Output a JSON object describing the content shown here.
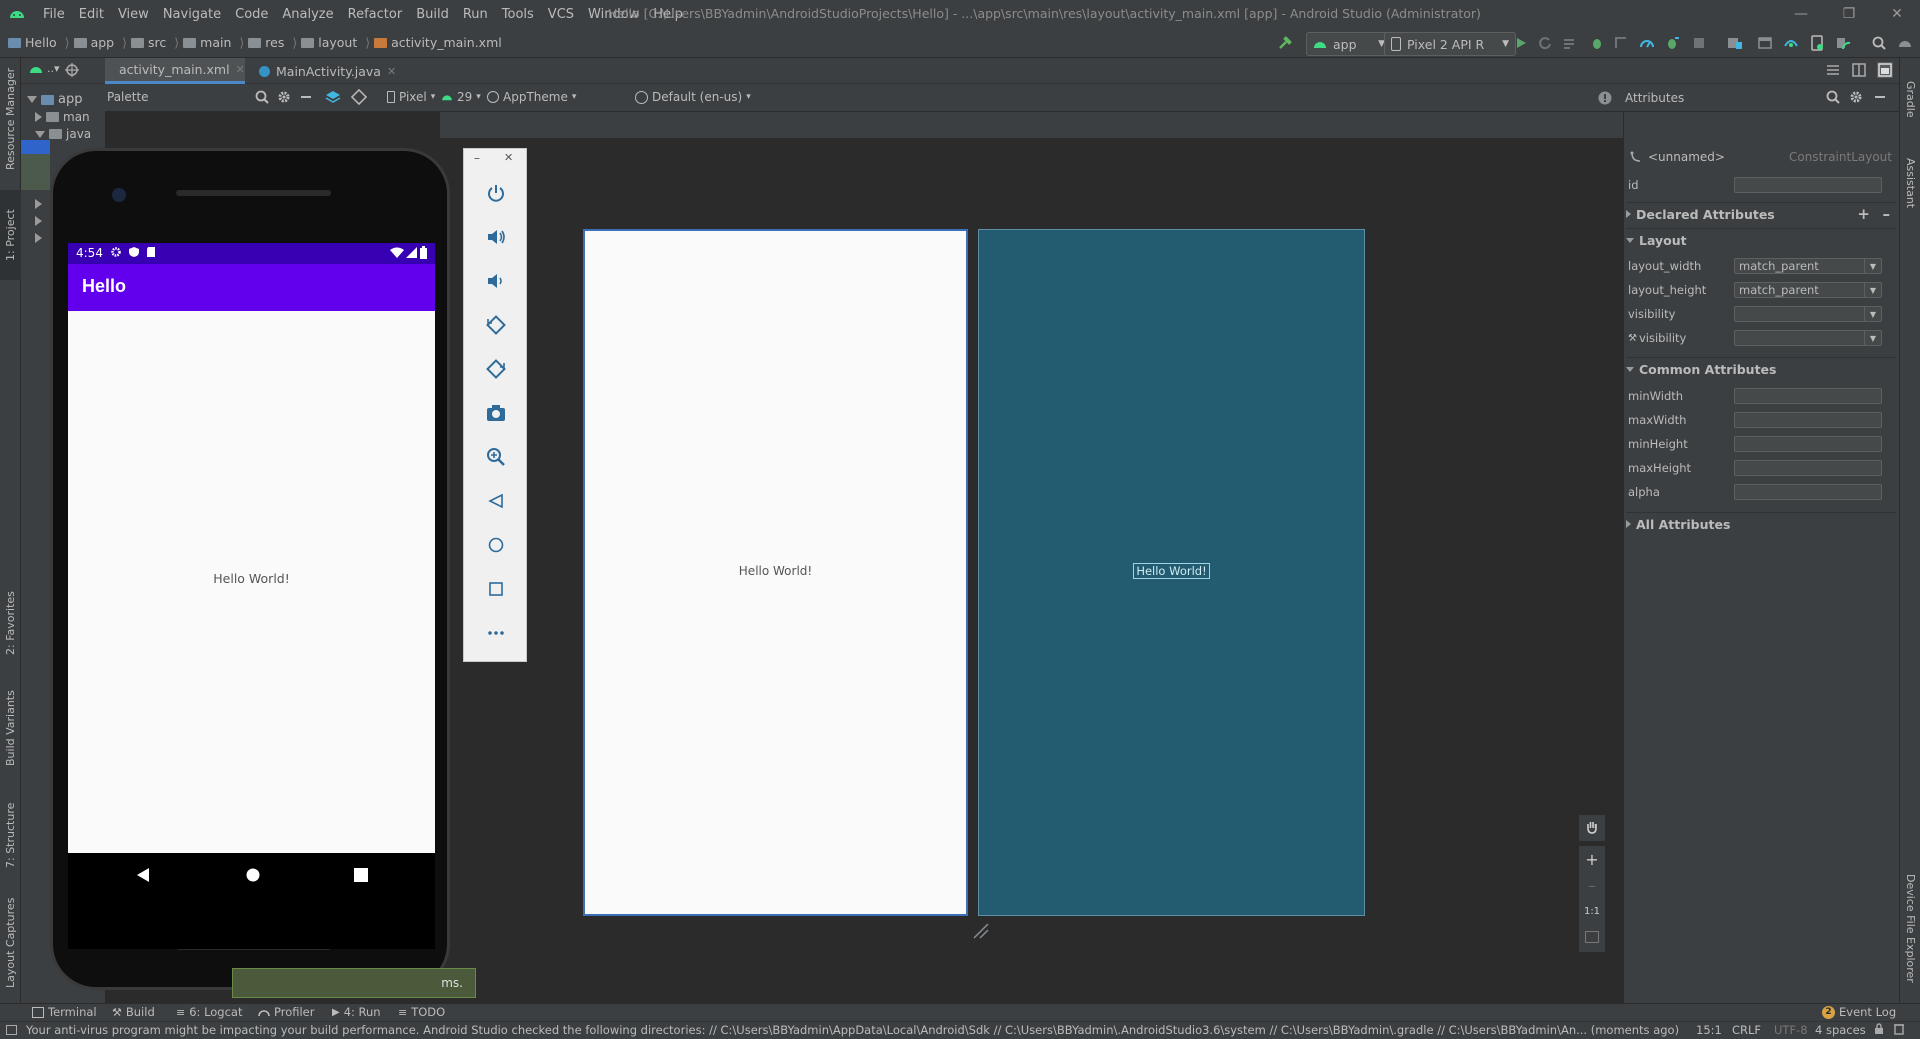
{
  "title_bar": {
    "menu": [
      "File",
      "Edit",
      "View",
      "Navigate",
      "Code",
      "Analyze",
      "Refactor",
      "Build",
      "Run",
      "Tools",
      "VCS",
      "Window",
      "Help"
    ],
    "window_title": "Hello [C:\\Users\\BBYadmin\\AndroidStudioProjects\\Hello] - ...\\app\\src\\main\\res\\layout\\activity_main.xml [app] - Android Studio (Administrator)"
  },
  "nav": {
    "breadcrumbs": [
      "Hello",
      "app",
      "src",
      "main",
      "res",
      "layout",
      "activity_main.xml"
    ],
    "run_config": "app",
    "device": "Pixel 2 API R"
  },
  "left_strip": {
    "resource_manager": "Resource Manager",
    "project": "1: Project",
    "favorites": "2: Favorites",
    "build_variants": "Build Variants",
    "structure": "7: Structure",
    "layout_captures": "Layout Captures"
  },
  "right_strip": {
    "gradle": "Gradle",
    "assistant": "Assistant",
    "device_file_explorer": "Device File Explorer"
  },
  "project_tree": {
    "root": "app",
    "items": [
      "man",
      "java"
    ]
  },
  "tabs": [
    {
      "label": "activity_main.xml",
      "active": true
    },
    {
      "label": "MainActivity.java",
      "active": false
    }
  ],
  "design_toolbar": {
    "palette": "Palette",
    "device": "Pixel",
    "api": "29",
    "theme": "AppTheme",
    "locale": "Default (en-us)"
  },
  "preview": {
    "text": "Hello World!"
  },
  "zoom": {
    "one_to_one": "1:1"
  },
  "attributes": {
    "header": "Attributes",
    "component": "<unnamed>",
    "component_type": "ConstraintLayout",
    "id_label": "id",
    "sections": {
      "declared": "Declared Attributes",
      "layout": "Layout",
      "common": "Common Attributes",
      "all": "All Attributes"
    },
    "layout_rows": [
      {
        "name": "layout_width",
        "value": "match_parent"
      },
      {
        "name": "layout_height",
        "value": "match_parent"
      },
      {
        "name": "visibility",
        "value": ""
      },
      {
        "name": "visibility",
        "value": ""
      }
    ],
    "common_rows": [
      {
        "name": "minWidth",
        "value": ""
      },
      {
        "name": "maxWidth",
        "value": ""
      },
      {
        "name": "minHeight",
        "value": ""
      },
      {
        "name": "maxHeight",
        "value": ""
      },
      {
        "name": "alpha",
        "value": ""
      }
    ]
  },
  "emulator": {
    "status_time": "4:54",
    "app_title": "Hello",
    "content_text": "Hello World!",
    "toast_text": "ms."
  },
  "bottom_tools": [
    {
      "label": "Terminal"
    },
    {
      "label": "Build"
    },
    {
      "label": "6: Logcat"
    },
    {
      "label": "Profiler"
    },
    {
      "label": "4: Run"
    },
    {
      "label": "TODO"
    }
  ],
  "event_log": "Event Log",
  "event_count": "2",
  "status": {
    "message": "Your anti-virus program might be impacting your build performance. Android Studio checked the following directories: // C:\\Users\\BBYadmin\\AppData\\Local\\Android\\Sdk // C:\\Users\\BBYadmin\\.AndroidStudio3.6\\system // C:\\Users\\BBYadmin\\.gradle // C:\\Users\\BBYadmin\\An... (moments ago)",
    "position": "15:1",
    "line_sep": "CRLF",
    "encoding": "UTF-8",
    "indent": "4 spaces"
  },
  "colors": {
    "ide_bg": "#2b2b2b",
    "panel": "#3c3f41",
    "accent_blue": "#4a88c7",
    "android_green": "#3ddc84",
    "app_bar_purple": "#6200ee",
    "status_bar_purple": "#3700b3",
    "blueprint": "#235b70"
  }
}
